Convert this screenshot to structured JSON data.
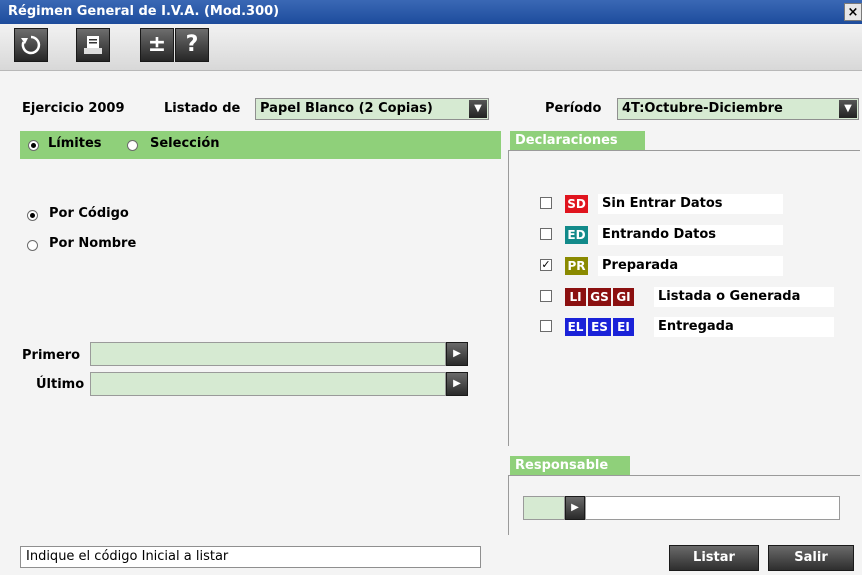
{
  "window": {
    "title": "Régimen General de I.V.A. (Mod.300)",
    "close_label": "×"
  },
  "toolbar": {
    "refresh_icon": "refresh-icon",
    "print_icon": "printer-icon",
    "plusminus_label": "±",
    "help_label": "?"
  },
  "header": {
    "ejercicio_label": "Ejercicio 2009",
    "listado_label": "Listado de",
    "listado_value": "Papel Blanco (2 Copias)",
    "periodo_label": "Período",
    "periodo_value": "4T:Octubre-Diciembre"
  },
  "mode": {
    "limites_label": "Límites",
    "seleccion_label": "Selección",
    "selected": "limites"
  },
  "order": {
    "codigo_label": "Por Código",
    "nombre_label": "Por Nombre",
    "selected": "codigo"
  },
  "range": {
    "primero_label": "Primero",
    "primero_value": "",
    "ultimo_label": "Último",
    "ultimo_value": ""
  },
  "declaraciones": {
    "title": "Declaraciones",
    "items": [
      {
        "checked": false,
        "badges": [
          "SD"
        ],
        "label": "Sin Entrar Datos"
      },
      {
        "checked": false,
        "badges": [
          "ED"
        ],
        "label": "Entrando Datos"
      },
      {
        "checked": true,
        "badges": [
          "PR"
        ],
        "label": "Preparada"
      },
      {
        "checked": false,
        "badges": [
          "LI",
          "GS",
          "GI"
        ],
        "label": "Listada o Generada"
      },
      {
        "checked": false,
        "badges": [
          "EL",
          "ES",
          "EI"
        ],
        "label": "Entregada"
      }
    ],
    "colors": {
      "SD": "#e0141e",
      "ED": "#128a8a",
      "PR": "#8a8a00",
      "LI": "#8b1010",
      "GS": "#8b1010",
      "GI": "#8b1010",
      "EL": "#1a22d8",
      "ES": "#1a22d8",
      "EI": "#1a22d8"
    }
  },
  "responsable": {
    "title": "Responsable",
    "value": ""
  },
  "statusbar": {
    "text": "Indique el código Inicial a listar"
  },
  "buttons": {
    "listar_label": "Listar",
    "salir_label": "Salir"
  },
  "colors": {
    "accent_green": "#8fd07a",
    "field_green": "#d6ead2",
    "title_blue": "#2a5aa8"
  }
}
